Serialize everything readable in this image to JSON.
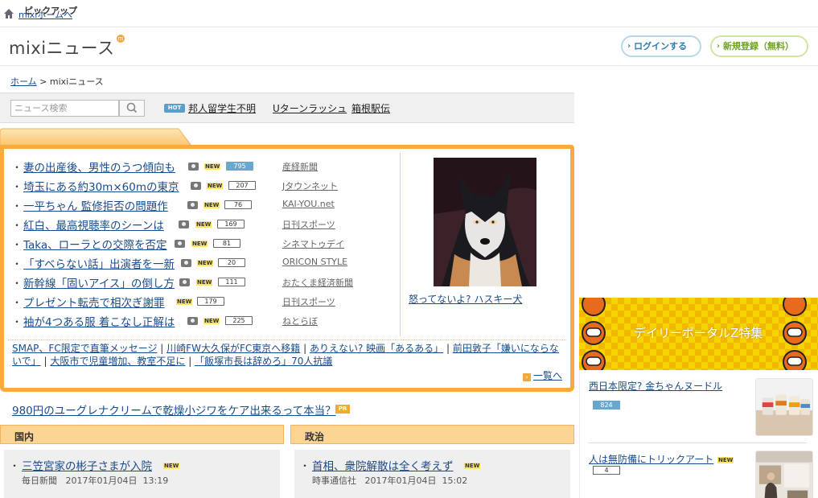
{
  "topbar": {
    "home_link": "mixiホームへ"
  },
  "header": {
    "logo": "mixiニュース",
    "logo_badge": "m",
    "login_label": "ログインする",
    "register_label": "新規登録（無料）"
  },
  "breadcrumb": {
    "home": "ホーム",
    "separator": ">",
    "current": "mixiニュース"
  },
  "search": {
    "placeholder": "ニュース検索",
    "hot_badge": "HOT",
    "hot_links": [
      "邦人留学生不明",
      "Uターンラッシュ",
      "箱根駅伝"
    ]
  },
  "pickup": {
    "tab_label": "ピックアップ",
    "items": [
      {
        "title": "妻の出産後、男性のうつ傾向も",
        "photo": true,
        "new": "NEW",
        "count": "795",
        "hot": true,
        "source": "産経新聞"
      },
      {
        "title": "埼玉にある約30m×60mの東京",
        "photo": true,
        "new": "NEW",
        "count": "207",
        "hot": false,
        "source": "Jタウンネット"
      },
      {
        "title": "一平ちゃん 監修拒否の問題作",
        "photo": true,
        "new": "NEW",
        "count": "76",
        "hot": false,
        "source": "KAI-YOU.net"
      },
      {
        "title": "紅白、最高視聴率のシーンは",
        "photo": true,
        "new": "NEW",
        "count": "169",
        "hot": false,
        "source": "日刊スポーツ"
      },
      {
        "title": "Taka、ローラとの交際を否定",
        "photo": true,
        "new": "NEW",
        "count": "81",
        "hot": false,
        "source": "シネマトゥデイ"
      },
      {
        "title": "「すべらない話」出演者を一新",
        "photo": true,
        "new": "NEW",
        "count": "20",
        "hot": false,
        "source": "ORICON STYLE"
      },
      {
        "title": "新幹線「固いアイス」の倒し方",
        "photo": true,
        "new": "NEW",
        "count": "111",
        "hot": false,
        "source": "おたくま経済新聞"
      },
      {
        "title": "プレゼント転売で相次ぎ謝罪",
        "photo": false,
        "new": "NEW",
        "count": "179",
        "hot": false,
        "source": "日刊スポーツ"
      },
      {
        "title": "袖が4つある服 着こなし正解は",
        "photo": true,
        "new": "NEW",
        "count": "225",
        "hot": false,
        "source": "ねとらぼ"
      }
    ],
    "photo_caption": "怒ってないよ? ハスキー犬",
    "sub_links": [
      "SMAP、FC限定で直筆メッセージ",
      "川崎FW大久保がFC東京へ移籍",
      "ありえない? 映画「あるある」",
      "前田敦子「嫌いにならないで」",
      "大阪市で児童増加、教室不足に",
      "「飯塚市長は辞めろ」70人抗議"
    ],
    "separator": "|",
    "more_link": "一覧へ"
  },
  "ad": {
    "text": "980円のユーグレナクリームで乾燥小ジワをケア出来るって本当？",
    "badge": "PR"
  },
  "categories": [
    {
      "label": "国内",
      "title": "三笠宮家の彬子さまが入院",
      "new": "NEW",
      "source": "毎日新聞",
      "date": "2017年01月04日",
      "time": "13:19"
    },
    {
      "label": "政治",
      "title": "首相、衆院解散は全く考えず",
      "new": "NEW",
      "source": "時事通信社",
      "date": "2017年01月04日",
      "time": "15:02"
    }
  ],
  "right": {
    "banner_label": "デイリーポータルZ特集",
    "items": [
      {
        "title": "西日本限定? 金ちゃんヌードル",
        "count": "824",
        "hot": true,
        "new": ""
      },
      {
        "title": "人は無防備にトリックアート",
        "count": "4",
        "hot": false,
        "new": "NEW"
      }
    ]
  },
  "colors": {
    "accent": "#f9aa3c",
    "link": "#1a4c8a",
    "count_hot": "#6aa7cf",
    "new_badge": "#ffe46b"
  }
}
